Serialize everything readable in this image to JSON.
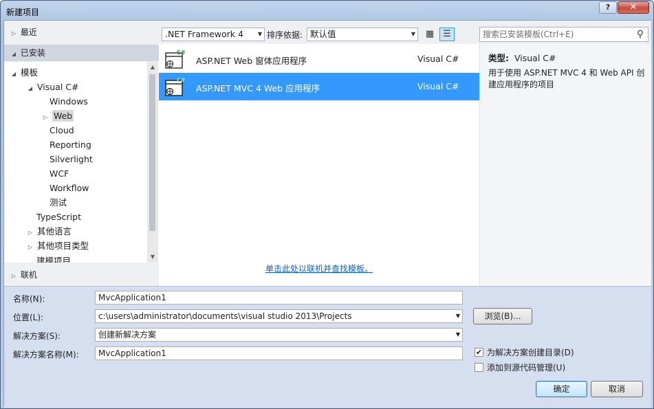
{
  "window": {
    "title": "新建项目",
    "help": "?",
    "close": "✕"
  },
  "tree": {
    "recent": "最近",
    "installed": "已安装",
    "online": "联机",
    "templates": "模板",
    "visual_csharp": "Visual C#",
    "children": [
      "Windows",
      "Web",
      "Cloud",
      "Reporting",
      "Silverlight",
      "WCF",
      "Workflow",
      "测试"
    ],
    "typescript": "TypeScript",
    "other_languages": "其他语言",
    "other_project_types": "其他项目类型",
    "partial": "建模项目"
  },
  "toolbar": {
    "framework": ".NET Framework 4",
    "sort_label": "排序依据:",
    "sort_value": "默认值",
    "search_placeholder": "搜索已安装模板(Ctrl+E)"
  },
  "templates": [
    {
      "name": "ASP.NET Web 窗体应用程序",
      "lang": "Visual C#",
      "selected": false
    },
    {
      "name": "ASP.NET MVC 4 Web 应用程序",
      "lang": "Visual C#",
      "selected": true
    }
  ],
  "online_link": "单击此处以联机并查找模板。",
  "description": {
    "type_label": "类型:",
    "type_value": "Visual C#",
    "text": "用于使用 ASP.NET MVC 4 和 Web API 创建应用程序的项目"
  },
  "form": {
    "name_label": "名称(N):",
    "name_value": "MvcApplication1",
    "location_label": "位置(L):",
    "location_value": "c:\\users\\administrator\\documents\\visual studio 2013\\Projects",
    "solution_label": "解决方案(S):",
    "solution_value": "创建新解决方案",
    "solution_name_label": "解决方案名称(M):",
    "solution_name_value": "MvcApplication1",
    "browse": "浏览(B)...",
    "create_dir": "为解决方案创建目录(D)",
    "create_dir_checked": true,
    "add_source": "添加到源代码管理(U)",
    "add_source_checked": false,
    "ok": "确定",
    "cancel": "取消"
  }
}
